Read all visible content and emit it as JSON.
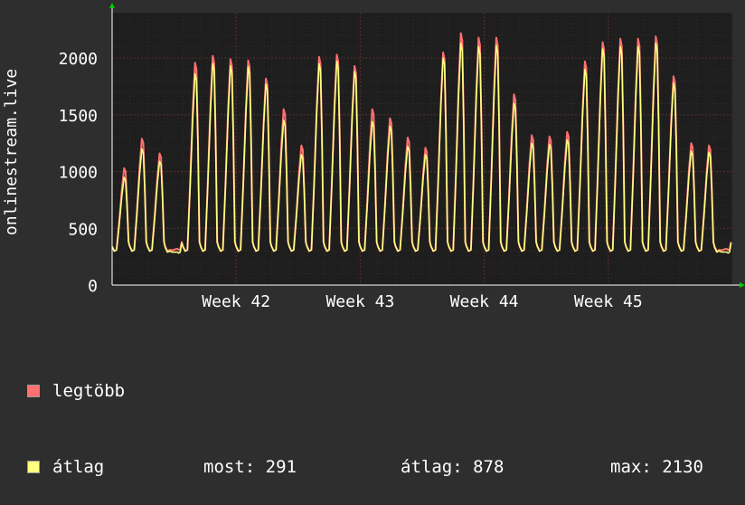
{
  "chart_data": {
    "type": "line",
    "ylabel": "onlinestream.live",
    "yticks": [
      0,
      500,
      1000,
      1500,
      2000
    ],
    "ytick_labels": [
      "0",
      "500",
      "1000",
      "1500",
      "2000"
    ],
    "ylim": [
      0,
      2400
    ],
    "xlim": [
      0,
      35
    ],
    "xticks": [
      {
        "pos": 7,
        "label": "Week 42"
      },
      {
        "pos": 14,
        "label": "Week 43"
      },
      {
        "pos": 21,
        "label": "Week 44"
      },
      {
        "pos": 28,
        "label": "Week 45"
      }
    ],
    "grid": true,
    "colors": {
      "background": "#2e2e2e",
      "plot_bg": "#1e1e1e",
      "grid": "#5a3030",
      "max_series": "#ff7070",
      "avg_series": "#ffff80",
      "axis_arrow": "#00cc00"
    },
    "series": [
      {
        "name": "legtöbb",
        "color": "#ff7070",
        "x": [
          0,
          1,
          2,
          3,
          4,
          5,
          6,
          7,
          8,
          9,
          10,
          11,
          12,
          13,
          14,
          15,
          16,
          17,
          18,
          19,
          20,
          21,
          22,
          23,
          24,
          25,
          26,
          27,
          28,
          29,
          30,
          31,
          32,
          33,
          34
        ],
        "values": [
          1030,
          1290,
          1160,
          320,
          1960,
          2020,
          1990,
          1980,
          1820,
          1550,
          1230,
          2010,
          2030,
          1930,
          1550,
          1470,
          1300,
          1210,
          2050,
          2220,
          2180,
          2180,
          1680,
          1320,
          1310,
          1350,
          1970,
          2140,
          2170,
          2170,
          2190,
          1840,
          1250,
          1230,
          320
        ]
      },
      {
        "name": "átlag",
        "color": "#ffff80",
        "x": [
          0,
          1,
          2,
          3,
          4,
          5,
          6,
          7,
          8,
          9,
          10,
          11,
          12,
          13,
          14,
          15,
          16,
          17,
          18,
          19,
          20,
          21,
          22,
          23,
          24,
          25,
          26,
          27,
          28,
          29,
          30,
          31,
          32,
          33,
          34
        ],
        "values": [
          950,
          1200,
          1090,
          290,
          1860,
          1950,
          1930,
          1920,
          1770,
          1450,
          1150,
          1950,
          1970,
          1880,
          1440,
          1400,
          1220,
          1150,
          2000,
          2130,
          2100,
          2110,
          1600,
          1250,
          1240,
          1280,
          1900,
          2080,
          2100,
          2100,
          2130,
          1780,
          1180,
          1170,
          291
        ]
      }
    ]
  },
  "legend": {
    "items": [
      {
        "label": "legtöbb",
        "color": "#ff7070"
      },
      {
        "label": "átlag",
        "color": "#ffff80"
      }
    ],
    "stats": {
      "most": "most: 291",
      "atlag": "átlag: 878",
      "max": "max: 2130"
    }
  }
}
